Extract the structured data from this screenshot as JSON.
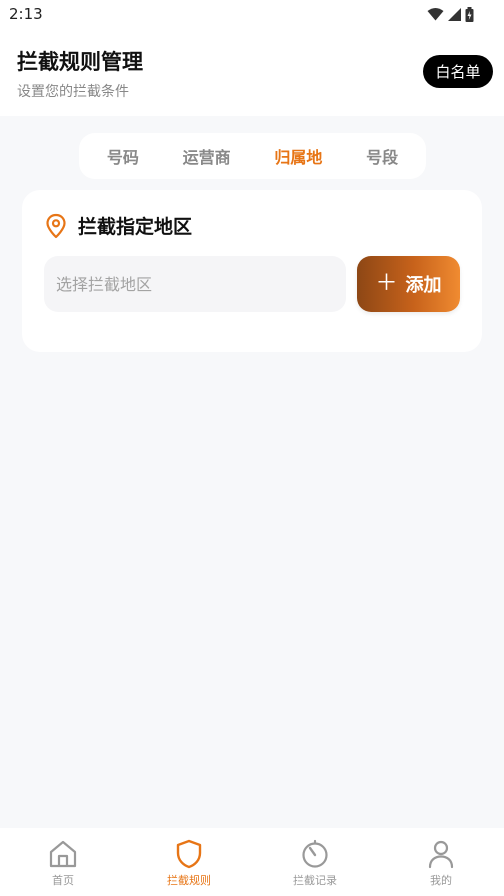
{
  "status_bar": {
    "time": "2:13"
  },
  "header": {
    "title": "拦截规则管理",
    "subtitle": "设置您的拦截条件",
    "whitelist_label": "白名单"
  },
  "tabs": [
    {
      "label": "号码",
      "active": false
    },
    {
      "label": "运营商",
      "active": false
    },
    {
      "label": "归属地",
      "active": true
    },
    {
      "label": "号段",
      "active": false
    }
  ],
  "card": {
    "icon": "location-pin-icon",
    "title": "拦截指定地区",
    "input_placeholder": "选择拦截地区",
    "input_value": "",
    "add_label": "添加"
  },
  "bottom_nav": [
    {
      "label": "首页",
      "icon": "home-icon",
      "active": false
    },
    {
      "label": "拦截规则",
      "icon": "shield-icon",
      "active": true
    },
    {
      "label": "拦截记录",
      "icon": "timer-icon",
      "active": false
    },
    {
      "label": "我的",
      "icon": "person-icon",
      "active": false
    }
  ],
  "colors": {
    "accent": "#e77516",
    "background": "#f7f8fa",
    "add_gradient_start": "#8d4715",
    "add_gradient_end": "#f08b31"
  }
}
